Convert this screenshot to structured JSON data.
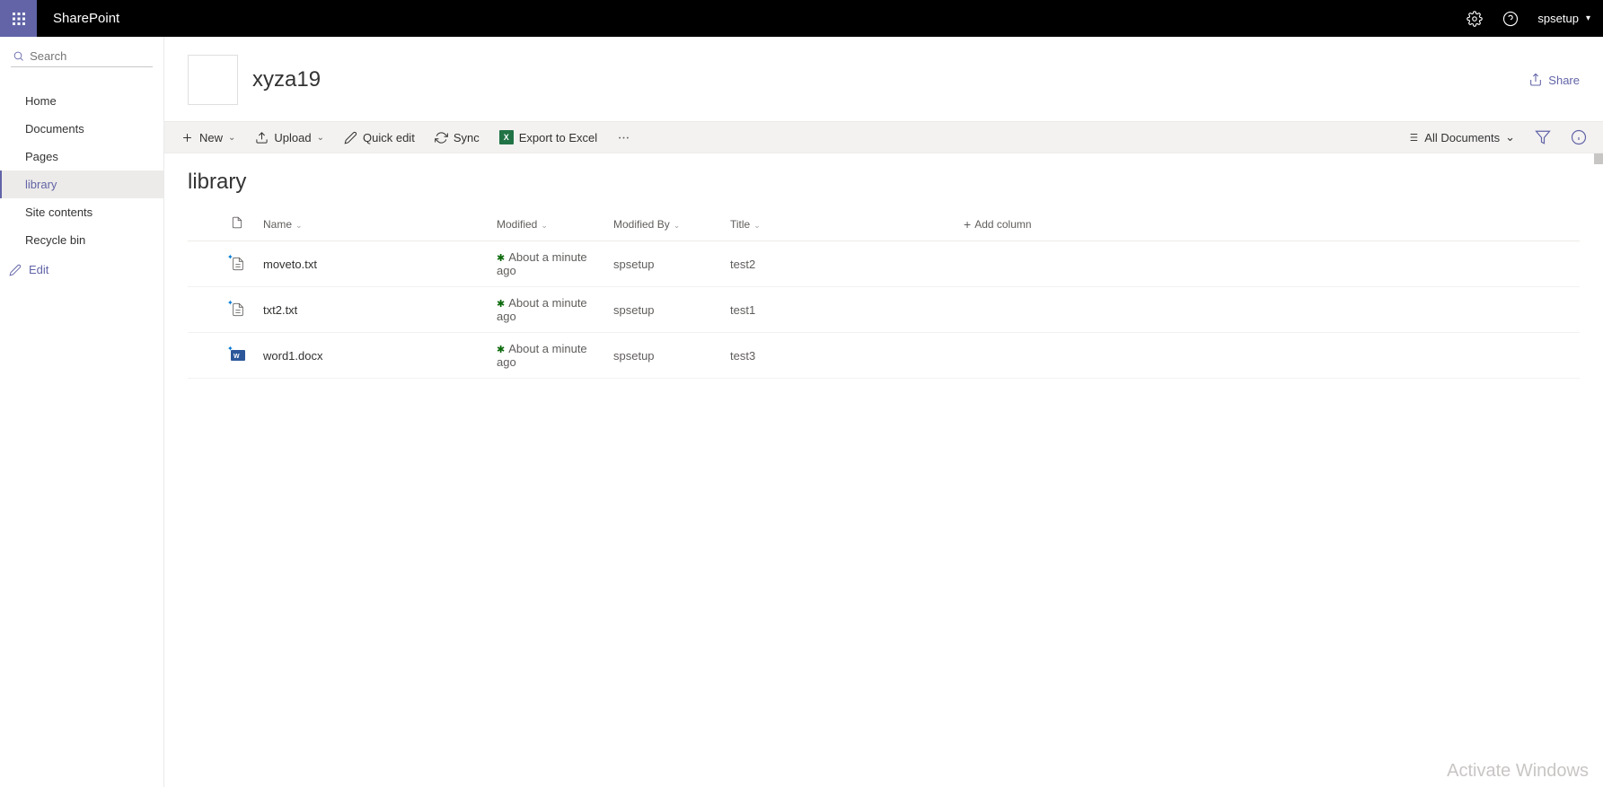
{
  "topbar": {
    "brand": "SharePoint",
    "user": "spsetup"
  },
  "search": {
    "placeholder": "Search"
  },
  "nav": {
    "items": [
      {
        "label": "Home"
      },
      {
        "label": "Documents"
      },
      {
        "label": "Pages"
      },
      {
        "label": "library",
        "active": true
      },
      {
        "label": "Site contents"
      },
      {
        "label": "Recycle bin"
      }
    ],
    "edit": "Edit"
  },
  "site": {
    "title": "xyza19"
  },
  "header_actions": {
    "share": "Share"
  },
  "commands": {
    "new": "New",
    "upload": "Upload",
    "quickedit": "Quick edit",
    "sync": "Sync",
    "export": "Export to Excel",
    "view": "All Documents"
  },
  "library": {
    "title": "library",
    "columns": {
      "name": "Name",
      "modified": "Modified",
      "modified_by": "Modified By",
      "title": "Title",
      "addcol": "Add column"
    },
    "rows": [
      {
        "name": "moveto.txt",
        "modified": "About a minute ago",
        "modified_by": "spsetup",
        "title": "test2",
        "type": "txt"
      },
      {
        "name": "txt2.txt",
        "modified": "About a minute ago",
        "modified_by": "spsetup",
        "title": "test1",
        "type": "txt"
      },
      {
        "name": "word1.docx",
        "modified": "About a minute ago",
        "modified_by": "spsetup",
        "title": "test3",
        "type": "docx"
      }
    ]
  },
  "watermark": "Activate Windows"
}
